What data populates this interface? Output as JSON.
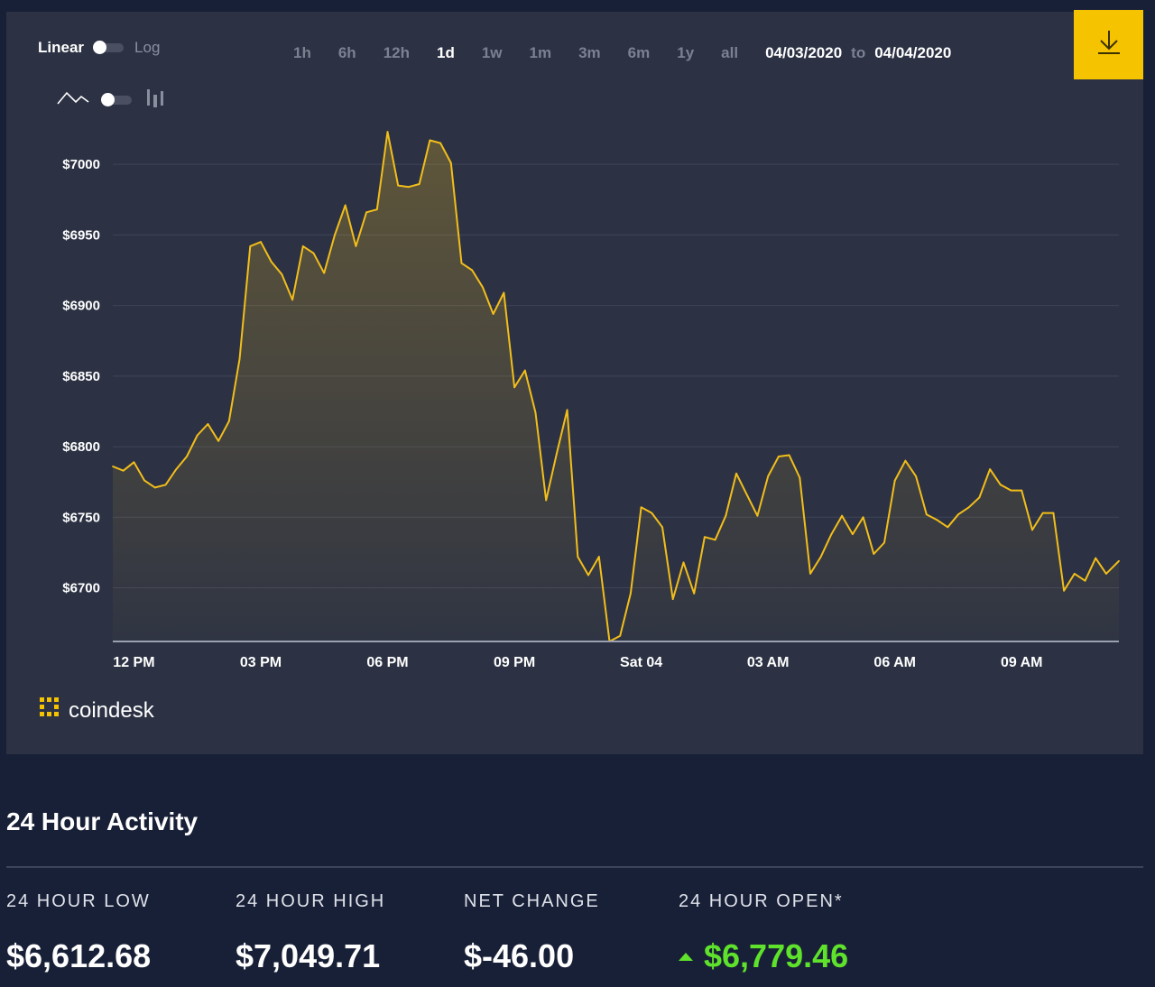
{
  "toolbar": {
    "scale_linear": "Linear",
    "scale_log": "Log",
    "ranges": [
      "1h",
      "6h",
      "12h",
      "1d",
      "1w",
      "1m",
      "3m",
      "6m",
      "1y",
      "all"
    ],
    "active_range": "1d",
    "date_from": "04/03/2020",
    "date_to_word": "to",
    "date_to": "04/04/2020"
  },
  "brand": {
    "name": "coindesk"
  },
  "colors": {
    "accent": "#f5c300",
    "line": "#f2be1a",
    "positive": "#5fe22b",
    "panel": "#2c3244",
    "page": "#182037"
  },
  "chart_data": {
    "type": "area",
    "ylim": [
      6662,
      7025
    ],
    "y_ticks": [
      {
        "value": 7000,
        "label": "$7000"
      },
      {
        "value": 6950,
        "label": "$6950"
      },
      {
        "value": 6900,
        "label": "$6900"
      },
      {
        "value": 6850,
        "label": "$6850"
      },
      {
        "value": 6800,
        "label": "$6800"
      },
      {
        "value": 6750,
        "label": "$6750"
      },
      {
        "value": 6700,
        "label": "$6700"
      }
    ],
    "x_ticks": [
      {
        "hour": 0,
        "label": "12 PM"
      },
      {
        "hour": 3,
        "label": "03 PM"
      },
      {
        "hour": 6,
        "label": "06 PM"
      },
      {
        "hour": 9,
        "label": "09 PM"
      },
      {
        "hour": 12,
        "label": "Sat 04"
      },
      {
        "hour": 15,
        "label": "03 AM"
      },
      {
        "hour": 18,
        "label": "06 AM"
      },
      {
        "hour": 21,
        "label": "09 AM"
      }
    ],
    "x_range_hours": [
      -0.5,
      23.3
    ],
    "series": [
      {
        "x": [
          -0.5,
          -0.25,
          0,
          0.25,
          0.5,
          0.75,
          1,
          1.25,
          1.5,
          1.75,
          2,
          2.25,
          2.5,
          2.75,
          3,
          3.25,
          3.5,
          3.75,
          4,
          4.25,
          4.5,
          4.75,
          5,
          5.25,
          5.5,
          5.75,
          6,
          6.25,
          6.5,
          6.75,
          7,
          7.25,
          7.5,
          7.75,
          8,
          8.25,
          8.5,
          8.75,
          9,
          9.25,
          9.5,
          9.75,
          10,
          10.25,
          10.5,
          10.75,
          11,
          11.25,
          11.5,
          11.75,
          12,
          12.25,
          12.5,
          12.75,
          13,
          13.25,
          13.5,
          13.75,
          14,
          14.25,
          14.5,
          14.75,
          15,
          15.25,
          15.5,
          15.75,
          16,
          16.25,
          16.5,
          16.75,
          17,
          17.25,
          17.5,
          17.75,
          18,
          18.25,
          18.5,
          18.75,
          19,
          19.25,
          19.5,
          19.75,
          20,
          20.25,
          20.5,
          20.75,
          21,
          21.25,
          21.5,
          21.75,
          22,
          22.25,
          22.5,
          22.75,
          23,
          23.3
        ],
        "values": [
          6786,
          6783,
          6789,
          6776,
          6771,
          6773,
          6784,
          6793,
          6808,
          6816,
          6804,
          6818,
          6862,
          6942,
          6945,
          6931,
          6922,
          6904,
          6942,
          6937,
          6923,
          6950,
          6971,
          6942,
          6966,
          6968,
          7023,
          6985,
          6984,
          6986,
          7017,
          7015,
          7001,
          6930,
          6925,
          6913,
          6894,
          6909,
          6842,
          6854,
          6824,
          6762,
          6795,
          6826,
          6722,
          6709,
          6722,
          6662,
          6666,
          6696,
          6757,
          6753,
          6743,
          6692,
          6718,
          6696,
          6736,
          6734,
          6751,
          6781,
          6766,
          6751,
          6779,
          6793,
          6794,
          6778,
          6710,
          6722,
          6738,
          6751,
          6738,
          6750,
          6724,
          6732,
          6776,
          6790,
          6779,
          6752,
          6748,
          6743,
          6752,
          6757,
          6764,
          6784,
          6773,
          6769,
          6769,
          6741,
          6753,
          6753,
          6698,
          6710,
          6705,
          6721,
          6710,
          6719
        ]
      }
    ]
  },
  "activity": {
    "title": "24 Hour Activity",
    "low_label": "24 HOUR LOW",
    "low_value": "$6,612.68",
    "high_label": "24 HOUR HIGH",
    "high_value": "$7,049.71",
    "change_label": "NET CHANGE",
    "change_value": "$-46.00",
    "open_label": "24 HOUR OPEN*",
    "open_value": "$6,779.46"
  }
}
